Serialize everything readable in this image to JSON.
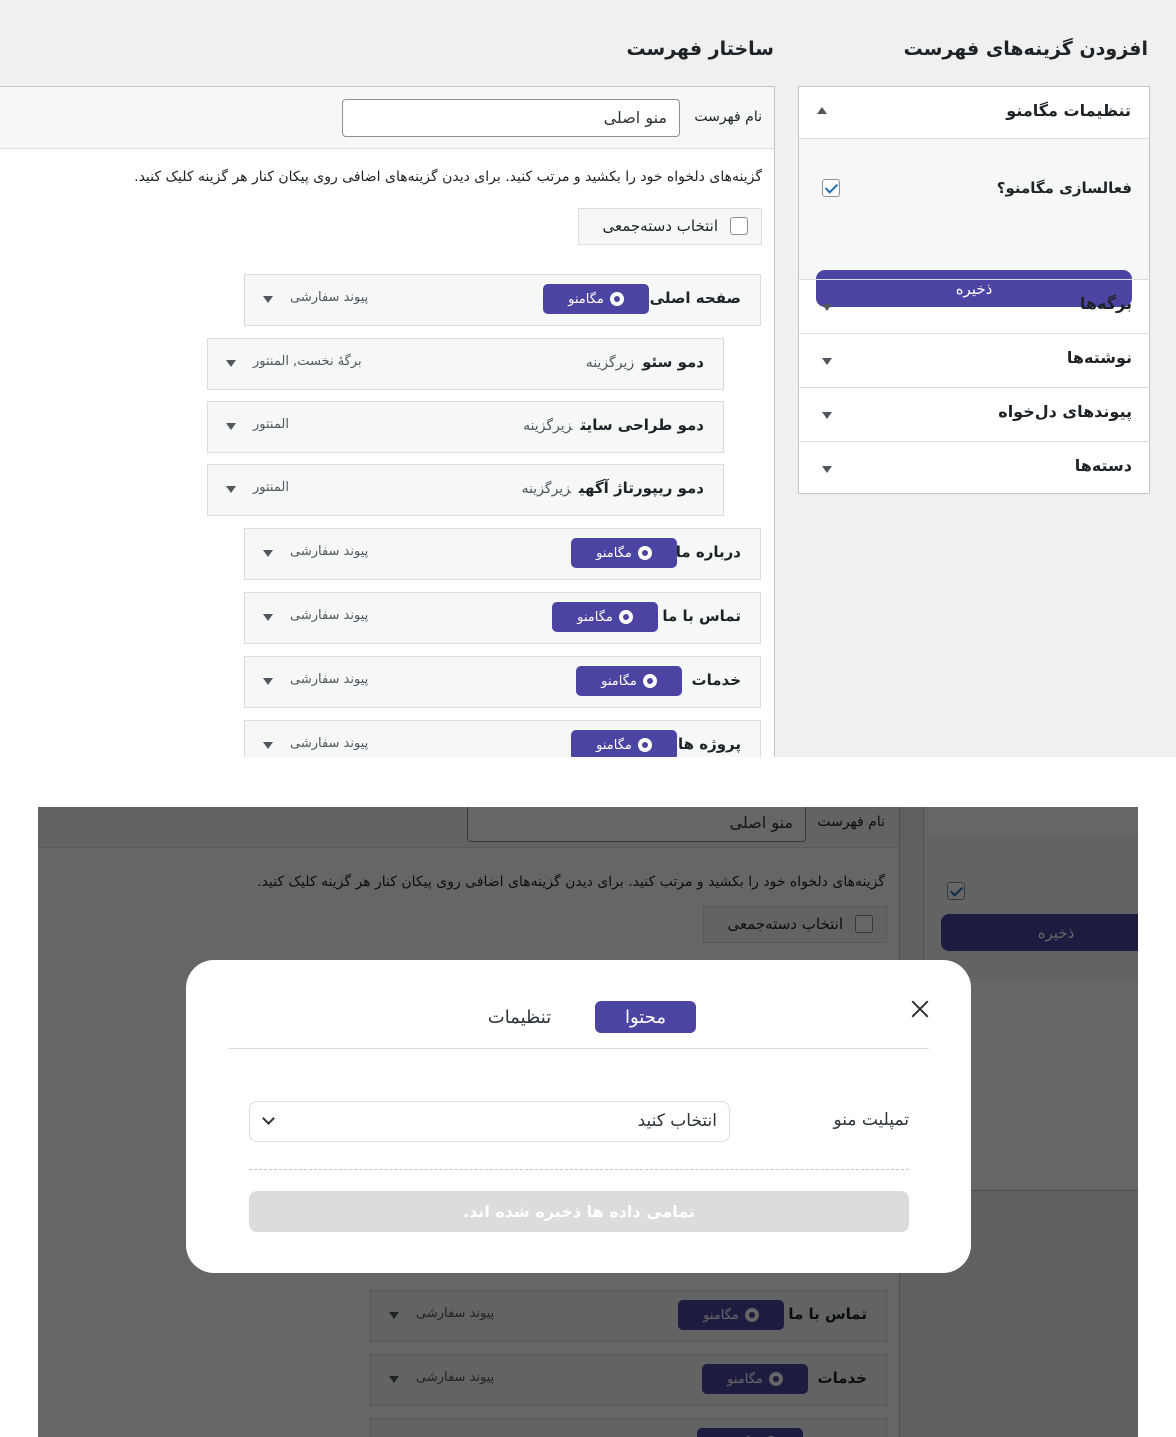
{
  "left": {
    "title": "افزودن گزینه‌های فهرست",
    "settings": {
      "title": "تنظیمات مگامنو",
      "enable_label": "فعالسازی مگامنو؟",
      "enable_checked": true,
      "save_label": "ذخیره"
    },
    "accordion": [
      "برگه‌ها",
      "نوشته‌ها",
      "پیوندهای دل‌خواه",
      "دسته‌ها"
    ]
  },
  "right": {
    "title": "ساختار فهرست",
    "menu_name_label": "نام فهرست",
    "menu_name_value": "منو اصلی",
    "instructions": "گزینه‌های دلخواه خود را بکشید و مرتب کنید. برای دیدن گزینه‌های اضافی روی پیکان کنار هر گزینه کلیک کنید.",
    "bulk_select_label": "انتخاب دسته‌جمعی",
    "items": [
      {
        "title": "صفحه اصلی",
        "sub": "",
        "type": "پیوند سفارشی",
        "badge": "مگامنو"
      },
      {
        "title": "دمو سئو",
        "sub": "زیرگزینه",
        "type": "برگهٔ نخست, المنتور",
        "badge": ""
      },
      {
        "title": "دمو طراحی سایت",
        "sub": "زیرگزینه",
        "type": "المنتور",
        "badge": ""
      },
      {
        "title": "دمو ریپورتاژ آگهی",
        "sub": "زیرگزینه",
        "type": "المنتور",
        "badge": ""
      },
      {
        "title": "درباره ما",
        "sub": "",
        "type": "پیوند سفارشی",
        "badge": "مگامنو"
      },
      {
        "title": "تماس با ما",
        "sub": "",
        "type": "پیوند سفارشی",
        "badge": "مگامنو"
      },
      {
        "title": "خدمات",
        "sub": "",
        "type": "پیوند سفارشی",
        "badge": "مگامنو"
      },
      {
        "title": "پروژه ها",
        "sub": "",
        "type": "پیوند سفارشی",
        "badge": "مگامنو"
      }
    ]
  },
  "modal": {
    "tabs": [
      "محتوا",
      "تنظیمات"
    ],
    "active_tab": "محتوا",
    "template_label": "تمپلیت منو",
    "template_value": "انتخاب کنید",
    "status_text": "تمامی داده ها ذخیره شده اند."
  },
  "colors": {
    "accent": "#4b44a2",
    "background": "#f0f0f1",
    "border": "#c3c4c7"
  }
}
